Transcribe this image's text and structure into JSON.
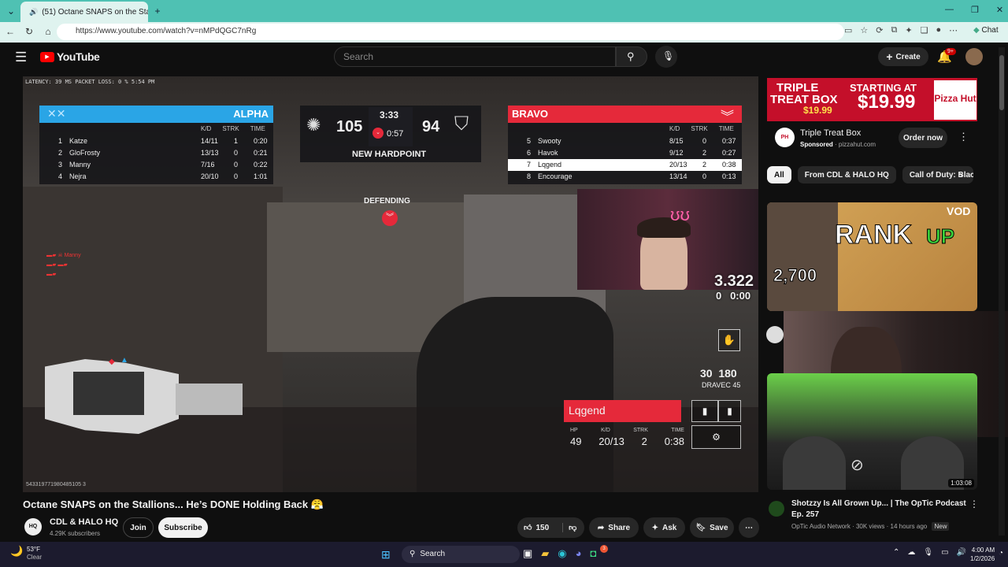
{
  "browser": {
    "tab_title": "(51) Octane SNAPS on the Sta",
    "url": "https://www.youtube.com/watch?v=nMPdQGC7nRg",
    "chat_label": "Chat"
  },
  "youtube": {
    "logo": "YouTube",
    "search_placeholder": "Search",
    "create_label": "Create",
    "notif_badge": "9+"
  },
  "video": {
    "latency": "LATENCY: 39 MS PACKET LOSS: 0 % 5:54 PM",
    "alpha": {
      "name": "ALPHA",
      "cols": [
        "K/D",
        "STRK",
        "TIME"
      ],
      "players": [
        {
          "n": "1",
          "name": "Katze",
          "kd": "14/11",
          "strk": "1",
          "time": "0:20"
        },
        {
          "n": "2",
          "name": "GloFrosty",
          "kd": "13/13",
          "strk": "0",
          "time": "0:21"
        },
        {
          "n": "3",
          "name": "Manny",
          "kd": "7/16",
          "strk": "0",
          "time": "0:22"
        },
        {
          "n": "4",
          "name": "Nejra",
          "kd": "20/10",
          "strk": "0",
          "time": "1:01"
        }
      ]
    },
    "bravo": {
      "name": "BRAVO",
      "cols": [
        "K/D",
        "STRK",
        "TIME"
      ],
      "players": [
        {
          "n": "5",
          "name": "Swooty",
          "kd": "8/15",
          "strk": "0",
          "time": "0:37"
        },
        {
          "n": "6",
          "name": "Havok",
          "kd": "9/12",
          "strk": "2",
          "time": "0:27"
        },
        {
          "n": "7",
          "name": "Lqgend",
          "kd": "20/13",
          "strk": "2",
          "time": "0:38"
        },
        {
          "n": "8",
          "name": "Encourage",
          "kd": "13/14",
          "strk": "0",
          "time": "0:13"
        }
      ]
    },
    "score_left": "105",
    "score_right": "94",
    "game_clock": "3:33",
    "hp_timer": "0:57",
    "mode": "NEW HARDPOINT",
    "defending": "DEFENDING",
    "cam_big": "3.322",
    "cam_small": "0   0:00",
    "ammo": "30  180",
    "weapon": "DRAVEC 45",
    "player_name": "Lqgend",
    "stats_labels": [
      "HP",
      "K/D",
      "STRK",
      "TIME"
    ],
    "stats_values": [
      "49",
      "20/13",
      "2",
      "0:38"
    ],
    "match_id": "543319771980485105 3",
    "killfeed": "Manny"
  },
  "ad": {
    "headline1": "TRIPLE",
    "headline2": "TREAT BOX",
    "starting": "STARTING AT",
    "price": "$19.99",
    "price_small": "$19.99",
    "brand": "Pizza Hut",
    "title": "Triple Treat Box",
    "sponsored": "Sponsored",
    "domain": "pizzahut.com",
    "cta": "Order now"
  },
  "chips": [
    "All",
    "From CDL & HALO HQ",
    "Call of Duty: Black"
  ],
  "thumb1": {
    "vod": "VOD",
    "rank": "RANK",
    "up": "UP",
    "amount": "2,700"
  },
  "rec": {
    "duration": "1:03:08",
    "title": "Shotzzy Is All Grown Up... | The OpTic Podcast Ep. 257",
    "meta": "OpTic Audio Network · 30K views · 14 hours ago",
    "badge": "New"
  },
  "watch": {
    "title": "Octane SNAPS on the Stallions... He’s DONE Holding Back 😤",
    "channel": "CDL & HALO HQ",
    "subs": "4.29K subscribers",
    "join": "Join",
    "subscribe": "Subscribe",
    "likes": "150",
    "share": "Share",
    "ask": "Ask",
    "save": "Save"
  },
  "taskbar": {
    "temp": "53°F",
    "weather": "Clear",
    "search": "Search",
    "time": "4:00 AM",
    "date": "1/2/2026",
    "badge": "3"
  }
}
